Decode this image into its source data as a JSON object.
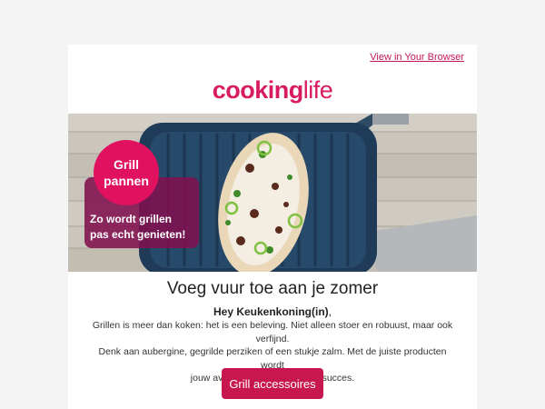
{
  "header": {
    "view_in_browser": "View in Your Browser",
    "logo_bold": "cooking",
    "logo_light": "life"
  },
  "hero": {
    "badge_line1": "Grill",
    "badge_line2": "pannen",
    "tagline_line1": "Zo wordt grillen",
    "tagline_line2": "pas echt genieten!"
  },
  "content": {
    "headline": "Voeg vuur toe aan je zomer",
    "greeting_name": "Hey Keukenkoning(in)",
    "greeting_punct": ",",
    "body_line1": "Grillen is meer dan koken: het is een beleving. Niet alleen stoer en robuust, maar ook verfijnd.",
    "body_line2": "Denk aan aubergine, gegrilde perziken of een stukje zalm. Met de juiste producten wordt",
    "body_line3": "jouw avond gegarandeerd een succes.",
    "cta_label": "Grill accessoires"
  },
  "colors": {
    "brand": "#d81b60",
    "cta": "#c8174f",
    "badge_box": "#80104e"
  }
}
